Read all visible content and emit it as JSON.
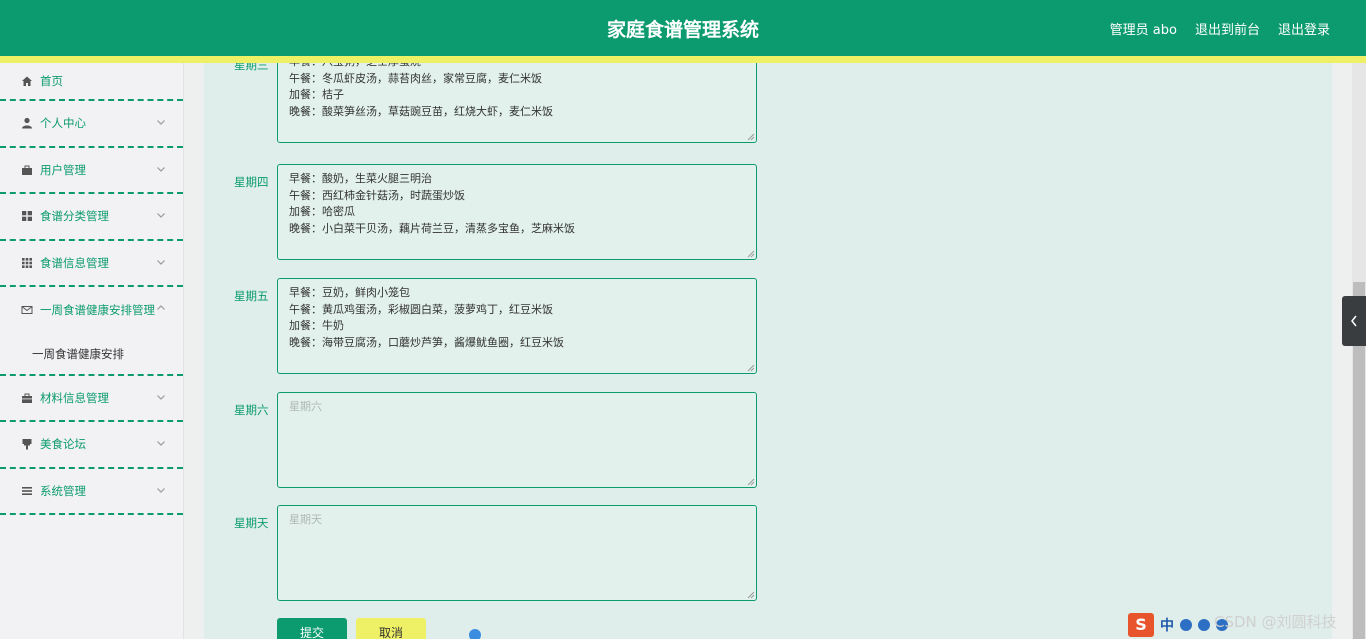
{
  "header": {
    "title": "家庭食谱管理系统",
    "admin_label": "管理员 abo",
    "back_to_front": "退出到前台",
    "logout": "退出登录"
  },
  "sidebar": {
    "items": [
      {
        "label": "首页",
        "icon": "home-icon"
      },
      {
        "label": "个人中心",
        "icon": "user-icon"
      },
      {
        "label": "用户管理",
        "icon": "briefcase-icon"
      },
      {
        "label": "食谱分类管理",
        "icon": "grid-icon"
      },
      {
        "label": "食谱信息管理",
        "icon": "apps-icon"
      },
      {
        "label": "一周食谱健康安排管理",
        "icon": "mail-icon"
      },
      {
        "label": "材料信息管理",
        "icon": "toolbox-icon"
      },
      {
        "label": "美食论坛",
        "icon": "brush-icon"
      },
      {
        "label": "系统管理",
        "icon": "list-icon"
      }
    ],
    "submenu_label": "一周食谱健康安排"
  },
  "form": {
    "rows": [
      {
        "label": "星期三",
        "value": "早餐：八宝粥，芝士厚蛋烧\n午餐：冬瓜虾皮汤，蒜苔肉丝，家常豆腐，麦仁米饭\n加餐：桔子\n晚餐：酸菜笋丝汤，草菇豌豆苗，红烧大虾，麦仁米饭",
        "placeholder": ""
      },
      {
        "label": "星期四",
        "value": "早餐：酸奶，生菜火腿三明治\n午餐：西红柿金针菇汤，时蔬蛋炒饭\n加餐：哈密瓜\n晚餐：小白菜干贝汤，藕片荷兰豆，清蒸多宝鱼，芝麻米饭",
        "placeholder": ""
      },
      {
        "label": "星期五",
        "value": "早餐：豆奶，鲜肉小笼包\n午餐：黄瓜鸡蛋汤，彩椒圆白菜，菠萝鸡丁，红豆米饭\n加餐：牛奶\n晚餐：海带豆腐汤，口蘑炒芦笋，酱爆鱿鱼圈，红豆米饭",
        "placeholder": ""
      },
      {
        "label": "星期六",
        "value": "",
        "placeholder": "星期六"
      },
      {
        "label": "星期天",
        "value": "",
        "placeholder": "星期天"
      }
    ],
    "submit_label": "提交",
    "cancel_label": "取消"
  },
  "overlay": {
    "watermark": "CSDN @刘圆科技",
    "ime_logo": "S",
    "ime_lang": "中"
  },
  "colors": {
    "primary": "#0c9b6e",
    "accent_yellow": "#eef066",
    "main_bg": "#dfeeea"
  }
}
